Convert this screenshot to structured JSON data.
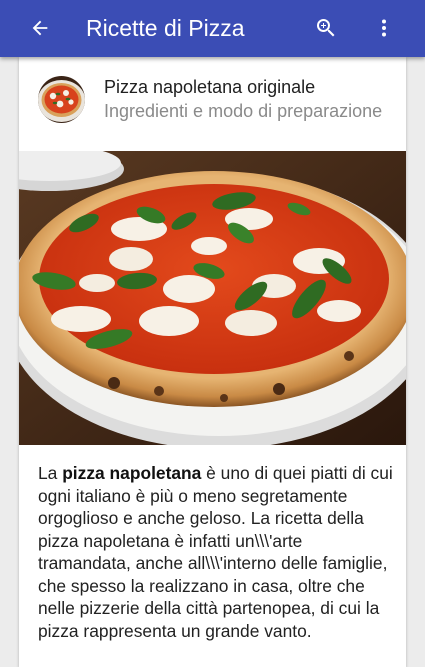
{
  "appbar": {
    "title": "Ricette di Pizza",
    "back_icon": "arrow-back-icon",
    "zoom_icon": "zoom-in-icon",
    "more_icon": "more-vert-icon",
    "color": "#3b4db5"
  },
  "card": {
    "title": "Pizza napoletana originale",
    "subtitle": "Ingredienti e modo di preparazione",
    "avatar_icon": "pizza-thumbnail",
    "image": "pizza-margherita-photo",
    "text_before": "La ",
    "text_bold": "pizza napoletana",
    "text_after": " è uno di quei piatti di cui ogni italiano è più o meno segretamente orgoglioso e anche geloso. La ricetta della pizza napoletana è infatti un\\\\\\'arte tramandata, anche all\\\\\\'interno delle famiglie, che spesso la realizzano in casa, oltre che nelle pizzerie della città partenopea, di cui la pizza rappresenta un grande vanto."
  }
}
